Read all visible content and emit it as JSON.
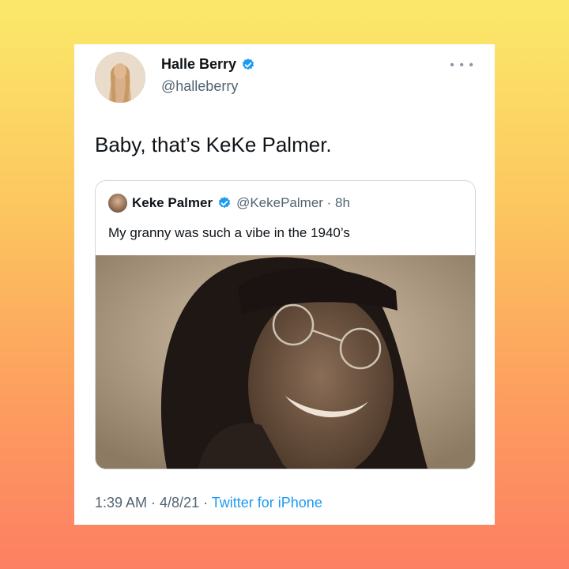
{
  "tweet": {
    "author_name": "Halle Berry",
    "author_handle": "@halleberry",
    "more_icon": "ellipsis-icon",
    "text": "Baby, that’s KeKe Palmer.",
    "quoted": {
      "author_name": "Keke Palmer",
      "meta": "@KekePalmer · 8h",
      "text": "My granny was such a vibe in the 1940’s"
    },
    "footer_time": "1:39 AM · 4/8/21 · ",
    "footer_source": "Twitter for iPhone"
  },
  "colors": {
    "accent": "#1d9bf0",
    "verified": "#1d9bf0",
    "text": "#0f1419",
    "secondary": "#536471",
    "background_top": "#fbe96a",
    "background_bottom": "#fd7f63"
  }
}
